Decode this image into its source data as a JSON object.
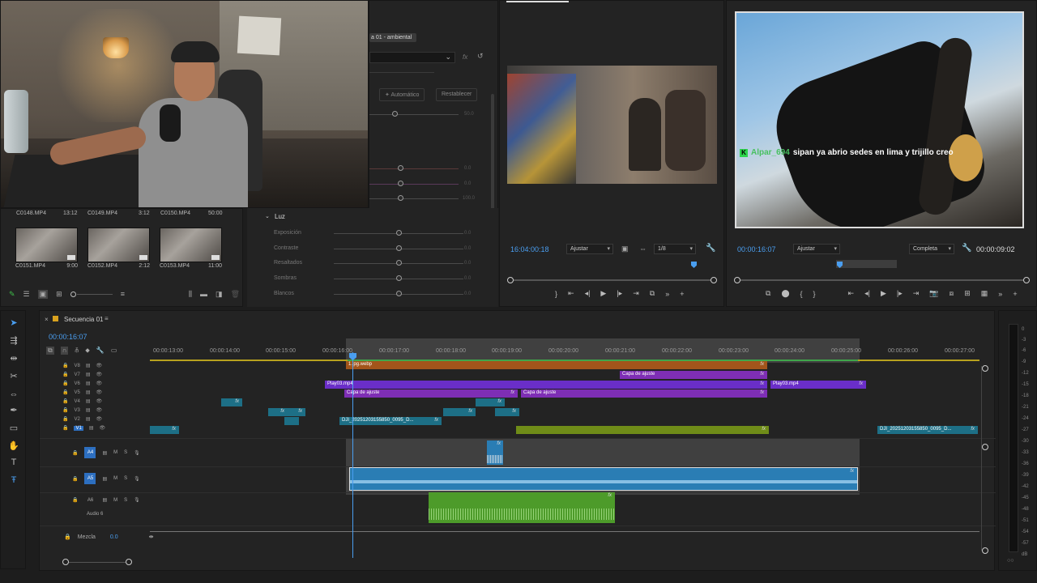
{
  "bin": {
    "top_clips": [
      {
        "name": "C0148.MP4",
        "dur": "13:12"
      },
      {
        "name": "C0149.MP4",
        "dur": "3:12"
      },
      {
        "name": "C0150.MP4",
        "dur": "50:00"
      }
    ],
    "clips": [
      {
        "name": "C0151.MP4",
        "dur": "9:00"
      },
      {
        "name": "C0152.MP4",
        "dur": "2:12"
      },
      {
        "name": "C0153.MP4",
        "dur": "11:00"
      }
    ]
  },
  "lumetri": {
    "clip_tag": "a 01 - ambiental",
    "auto_button": "Automático",
    "reset_button": "Restablecer",
    "values": [
      "50.0",
      "0.0",
      "0.0",
      "100.0"
    ],
    "luz_header": "Luz",
    "luz_labels": [
      "Exposición",
      "Contraste",
      "Resaltados",
      "Sombras",
      "Blancos"
    ],
    "luz_values": [
      "0.0",
      "0.0",
      "0.0",
      "0.0",
      "0.0"
    ]
  },
  "source": {
    "timecode": "16:04:00:18",
    "fit": "Ajustar",
    "resolution": "1/8"
  },
  "program": {
    "timecode": "00:00:16:07",
    "fit": "Ajustar",
    "quality": "Completa",
    "duration": "00:00:09:02",
    "chat_user": "Alpar_694",
    "chat_message": "sipan ya abrio sedes en lima y trijillo creo"
  },
  "timeline": {
    "sequence_name": "Secuencia 01",
    "timecode": "00:00:16:07",
    "ruler_ticks": [
      "00:00:13:00",
      "00:00:14:00",
      "00:00:15:00",
      "00:00:16:00",
      "00:00:17:00",
      "00:00:18:00",
      "00:00:19:00",
      "00:00:20:00",
      "00:00:21:00",
      "00:00:22:00",
      "00:00:23:00",
      "00:00:24:00",
      "00:00:25:00",
      "00:00:26:00",
      "00:00:27:00"
    ],
    "video_tracks": [
      "V8",
      "V7",
      "V6",
      "V5",
      "V4",
      "V3",
      "V2",
      "V1"
    ],
    "audio_tracks": [
      "A4",
      "A5",
      "A6"
    ],
    "audio6_name": "Audio 6",
    "mix_label": "Mezcla",
    "mix_value": "0.0",
    "clip_jpg": "1.jpg.webp",
    "clip_capa1": "Capa de ajuste",
    "clip_play03a": "Play03.mp4",
    "clip_play03b": "Play03.mp4",
    "clip_capa2": "Capa de ajuste",
    "clip_capa3": "Capa de ajuste",
    "clip_dji1": "DJI_20251203155850_0095_D...",
    "clip_dji2": "DJI_20251203155850_0095_D...",
    "fx": "fx"
  },
  "meter": {
    "labels": [
      "0",
      "-3",
      "-6",
      "-9",
      "-12",
      "-15",
      "-18",
      "-21",
      "-24",
      "-27",
      "-30",
      "-33",
      "-36",
      "-39",
      "-42",
      "-45",
      "-48",
      "-51",
      "-54",
      "-57",
      "dB"
    ]
  }
}
